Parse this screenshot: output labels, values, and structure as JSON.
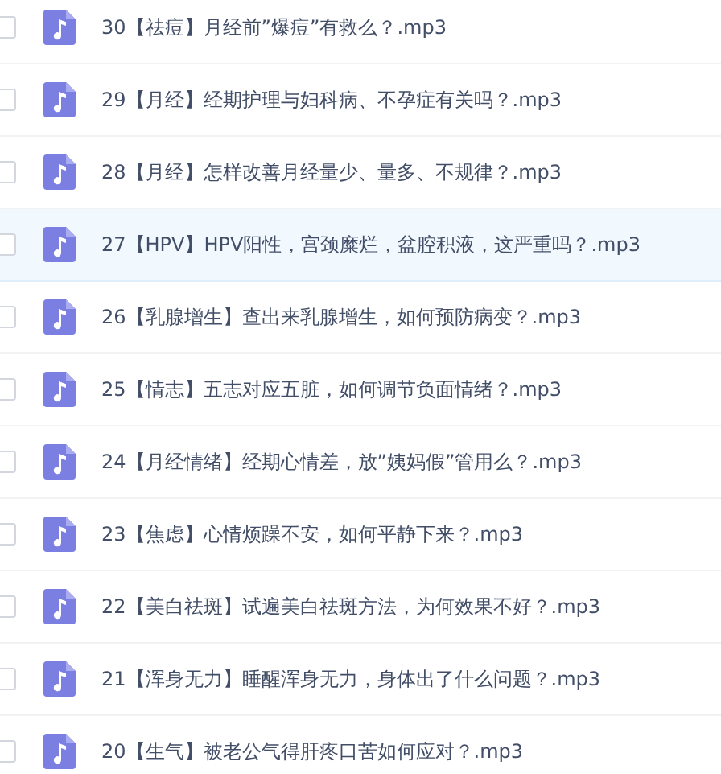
{
  "files": [
    {
      "name": "30【祛痘】月经前”爆痘”有救么？.mp3",
      "checked": false,
      "selected": false
    },
    {
      "name": "29【月经】经期护理与妇科病、不孕症有关吗？.mp3",
      "checked": false,
      "selected": false
    },
    {
      "name": "28【月经】怎样改善月经量少、量多、不规律？.mp3",
      "checked": false,
      "selected": false
    },
    {
      "name": "27【HPV】HPV阳性，宫颈糜烂，盆腔积液，这严重吗？.mp3",
      "checked": false,
      "selected": true
    },
    {
      "name": "26【乳腺增生】查出来乳腺增生，如何预防病变？.mp3",
      "checked": false,
      "selected": false
    },
    {
      "name": "25【情志】五志对应五脏，如何调节负面情绪？.mp3",
      "checked": false,
      "selected": false
    },
    {
      "name": "24【月经情绪】经期心情差，放”姨妈假”管用么？.mp3",
      "checked": false,
      "selected": false
    },
    {
      "name": "23【焦虑】心情烦躁不安，如何平静下来？.mp3",
      "checked": false,
      "selected": false
    },
    {
      "name": "22【美白祛斑】试遍美白祛斑方法，为何效果不好？.mp3",
      "checked": false,
      "selected": false
    },
    {
      "name": "21【浑身无力】睡醒浑身无力，身体出了什么问题？.mp3",
      "checked": false,
      "selected": false
    },
    {
      "name": "20【生气】被老公气得肝疼口苦如何应对？.mp3",
      "checked": false,
      "selected": false
    }
  ]
}
